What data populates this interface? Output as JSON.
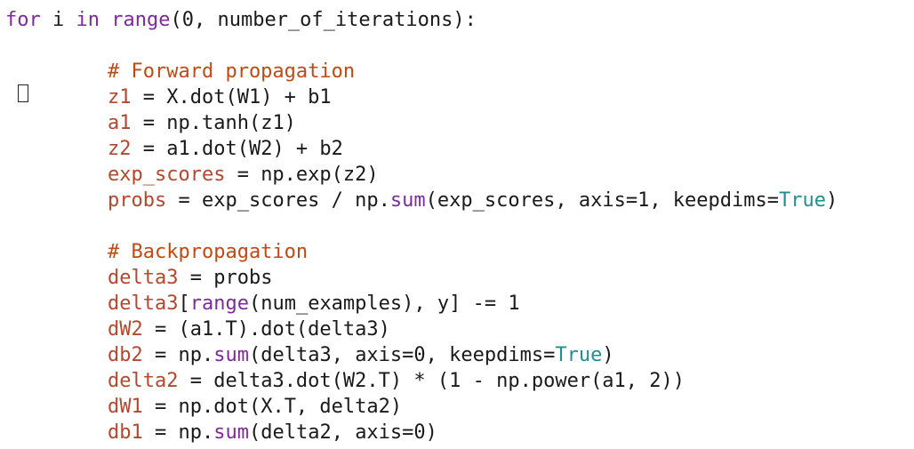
{
  "code": {
    "l1": {
      "t1": "for",
      "t2": " i ",
      "t3": "in",
      "t4": " ",
      "t5": "range",
      "t6": "(0, number_of_iterations):"
    },
    "c1": "# Forward propagation",
    "l3": {
      "v": "z1",
      "r": " = X.dot(W1) + b1"
    },
    "l4": {
      "v": "a1",
      "r": " = np.tanh(z1)"
    },
    "l5": {
      "v": "z2",
      "r": " = a1.dot(W2) + b2"
    },
    "l6": {
      "v": "exp_scores",
      "r": " = np.exp(z2)"
    },
    "l7": {
      "v": "probs",
      "r1": " = exp_scores / np.",
      "fn": "sum",
      "r2": "(exp_scores, axis=1, keepdims=",
      "tr": "True",
      "r3": ")"
    },
    "c2": "# Backpropagation",
    "l9": {
      "v": "delta3",
      "r": " = probs"
    },
    "l10": {
      "v": "delta3",
      "r1": "[",
      "fn": "range",
      "r2": "(num_examples), y] -= 1"
    },
    "l11": {
      "v": "dW2",
      "r": " = (a1.T).dot(delta3)"
    },
    "l12": {
      "v": "db2",
      "r1": " = np.",
      "fn": "sum",
      "r2": "(delta3, axis=0, keepdims=",
      "tr": "True",
      "r3": ")"
    },
    "l13": {
      "v": "delta2",
      "r": " = delta3.dot(W2.T) * (1 - np.power(a1, 2))"
    },
    "l14": {
      "v": "dW1",
      "r": " = np.dot(X.T, delta2)"
    },
    "l15": {
      "v": "db1",
      "r1": " = np.",
      "fn": "sum",
      "r2": "(delta2, axis=0)"
    }
  },
  "colors": {
    "keyword": "#7f2a9c",
    "comment": "#c14a14",
    "variable": "#b5472c",
    "builtin_true": "#1f8f8f"
  },
  "gutter": {
    "marker_icon": "breakpoint-box-icon"
  }
}
